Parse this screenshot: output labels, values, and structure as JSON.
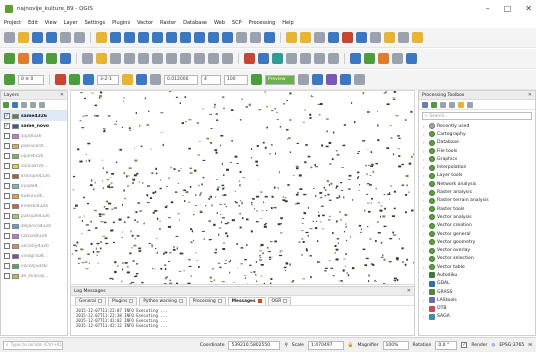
{
  "window": {
    "title": "najnovije_kulture_89 - QGIS",
    "minimize": "–",
    "maximize": "□",
    "close": "✕"
  },
  "menu": [
    "Project",
    "Edit",
    "View",
    "Layer",
    "Settings",
    "Plugins",
    "Vector",
    "Raster",
    "Database",
    "Web",
    "SCP",
    "Processing",
    "Help"
  ],
  "toolbar3": {
    "scp_band": "0 ≡ 0",
    "rgb_value": "3-2-1",
    "dist_value": "0.012000",
    "max_value": "4",
    "max2_value": "100",
    "preview_label": "Preview"
  },
  "layers": {
    "title": "Layers",
    "items": [
      {
        "name": "same4326",
        "checked": true,
        "style": "active",
        "color": "#6a7f3a",
        "selected": true
      },
      {
        "name": "same_novo",
        "checked": true,
        "style": "active",
        "color": "#3a5b8a"
      },
      {
        "name": "suja4326",
        "checked": false,
        "style": "inactive",
        "color": "#c67ad8"
      },
      {
        "name": "psenicer4...",
        "checked": false,
        "style": "inactive",
        "color": "#d3b04a"
      },
      {
        "name": "uljan4326",
        "checked": false,
        "style": "inactive",
        "color": "#7fb35a"
      },
      {
        "name": "suncokret...",
        "checked": false,
        "style": "inactive",
        "color": "#e8d23a"
      },
      {
        "name": "krompir4326",
        "checked": false,
        "style": "inactive",
        "color": "#a0613b"
      },
      {
        "name": "livade4...",
        "checked": false,
        "style": "inactive",
        "color": "#6fc2a8"
      },
      {
        "name": "kukuruz4...",
        "checked": false,
        "style": "inactive",
        "color": "#e1a43c"
      },
      {
        "name": "kineski4326",
        "checked": false,
        "style": "inactive",
        "color": "#cc5b5b"
      },
      {
        "name": "pasnjak4326",
        "checked": false,
        "style": "inactive",
        "color": "#9bd16a"
      },
      {
        "name": "zeljarica4326",
        "checked": false,
        "style": "inactive",
        "color": "#5a9fd4"
      },
      {
        "name": "raznas4326",
        "checked": false,
        "style": "inactive",
        "color": "#b57ad1"
      },
      {
        "name": "ukrasnj4326",
        "checked": false,
        "style": "inactive",
        "color": "#d48c5a"
      },
      {
        "name": "vinograd4...",
        "checked": false,
        "style": "inactive",
        "color": "#7a4fa8"
      },
      {
        "name": "voce/ljudski",
        "checked": false,
        "style": "inactive",
        "color": "#4fa85e"
      },
      {
        "name": "ze_livanay...",
        "checked": false,
        "style": "inactive",
        "color": "#c2b84f"
      }
    ]
  },
  "log": {
    "title": "Log Messages",
    "tabs": [
      {
        "label": "General",
        "alert": false
      },
      {
        "label": "Plugins",
        "alert": false
      },
      {
        "label": "Python warning",
        "alert": false
      },
      {
        "label": "Processing",
        "alert": false
      },
      {
        "label": "Messages",
        "alert": true,
        "active": true
      },
      {
        "label": "OGR",
        "alert": false
      }
    ],
    "lines": [
      "2015-12-07T11:22:07   INFO   Executing ...",
      "2015-12-07T11:22:38   INFO   Executing ...",
      "2015-12-07T11:42:02   INFO   Executing ...",
      "2015-12-07T11:42:12   INFO   Executing ..."
    ]
  },
  "processing": {
    "title": "Processing Toolbox",
    "search_placeholder": "Search...",
    "items": [
      {
        "label": "Recently used",
        "kind": "clock",
        "arrow": "›"
      },
      {
        "label": "Cartography",
        "kind": "gear",
        "arrow": "›"
      },
      {
        "label": "Database",
        "kind": "gear",
        "arrow": "›"
      },
      {
        "label": "File tools",
        "kind": "gear",
        "arrow": "›"
      },
      {
        "label": "Graphics",
        "kind": "gear",
        "arrow": "›"
      },
      {
        "label": "Interpolation",
        "kind": "gear",
        "arrow": "›"
      },
      {
        "label": "Layer tools",
        "kind": "gear",
        "arrow": "›"
      },
      {
        "label": "Network analysis",
        "kind": "gear",
        "arrow": "›"
      },
      {
        "label": "Raster analysis",
        "kind": "gear",
        "arrow": "›"
      },
      {
        "label": "Raster terrain analysis",
        "kind": "gear",
        "arrow": "›"
      },
      {
        "label": "Raster tools",
        "kind": "gear",
        "arrow": "›"
      },
      {
        "label": "Vector analysis",
        "kind": "gear",
        "arrow": "›"
      },
      {
        "label": "Vector creation",
        "kind": "gear",
        "arrow": "›"
      },
      {
        "label": "Vector general",
        "kind": "gear",
        "arrow": "›"
      },
      {
        "label": "Vector geometry",
        "kind": "gear",
        "arrow": "›"
      },
      {
        "label": "Vector overlay",
        "kind": "gear",
        "arrow": "›"
      },
      {
        "label": "Vector selection",
        "kind": "gear",
        "arrow": "›"
      },
      {
        "label": "Vector table",
        "kind": "gear",
        "arrow": "›"
      },
      {
        "label": "Autodiku",
        "kind": "prov",
        "color": "#3a7d3a",
        "arrow": "›"
      },
      {
        "label": "GDAL",
        "kind": "prov",
        "color": "#2c6fb5",
        "arrow": "›"
      },
      {
        "label": "GRASS",
        "kind": "prov",
        "color": "#4b8b3b",
        "arrow": "›"
      },
      {
        "label": "LAStools",
        "kind": "prov",
        "color": "#6b6bb5",
        "arrow": "›"
      },
      {
        "label": "OTB",
        "kind": "prov",
        "color": "#c94b4b",
        "arrow": "›"
      },
      {
        "label": "SAGA",
        "kind": "prov",
        "color": "#3a8fb5",
        "arrow": "›"
      }
    ]
  },
  "statusbar": {
    "locate_placeholder": "Type to locate (Ctrl+K)",
    "coordinate_label": "Coordinate",
    "coordinate_value": "539210,5802550",
    "scale_label": "Scale",
    "scale_value": "1:470497",
    "magnifier_label": "Magnifier",
    "magnifier_value": "100%",
    "rotation_label": "Rotation",
    "rotation_value": "0.0 °",
    "render_label": "Render",
    "crs_label": "EPSG:3765"
  },
  "colors": {
    "map_feature": "#2f3d28",
    "map_feature_highlight": "#6b8f45",
    "accent_blue": "#3b78c4"
  }
}
